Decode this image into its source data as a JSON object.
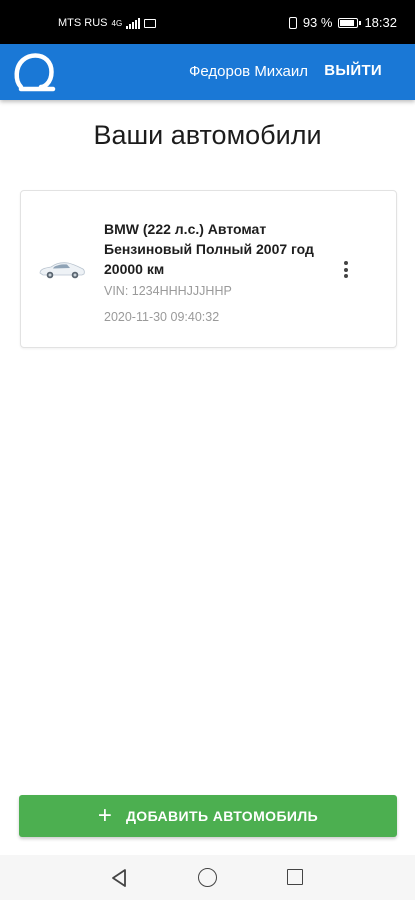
{
  "status_bar": {
    "carrier": "MTS RUS",
    "network": "4G",
    "battery": "93 %",
    "battery_level": 0.93,
    "time": "18:32"
  },
  "app_bar": {
    "logo_icon": "app-logo-icon",
    "user_name": "Федоров Михаил",
    "logout_label": "ВЫЙТИ",
    "color": "#1a78d6"
  },
  "page": {
    "title": "Ваши автомобили"
  },
  "cars": [
    {
      "title": "BMW (222 л.с.) Автомат Бензиновый Полный 2007 год 20000 км",
      "vin": "VIN: 1234HHHJJJHHP",
      "date": "2020-11-30 09:40:32",
      "image_icon": "car-icon",
      "menu_icon": "more-vert-icon"
    }
  ],
  "add_button": {
    "icon": "+",
    "label": "ДОБАВИТЬ АВТОМОБИЛЬ",
    "color": "#4caf50"
  },
  "nav": {
    "back_icon": "back-triangle-icon",
    "home_icon": "home-circle-icon",
    "recent_icon": "recent-square-icon"
  }
}
